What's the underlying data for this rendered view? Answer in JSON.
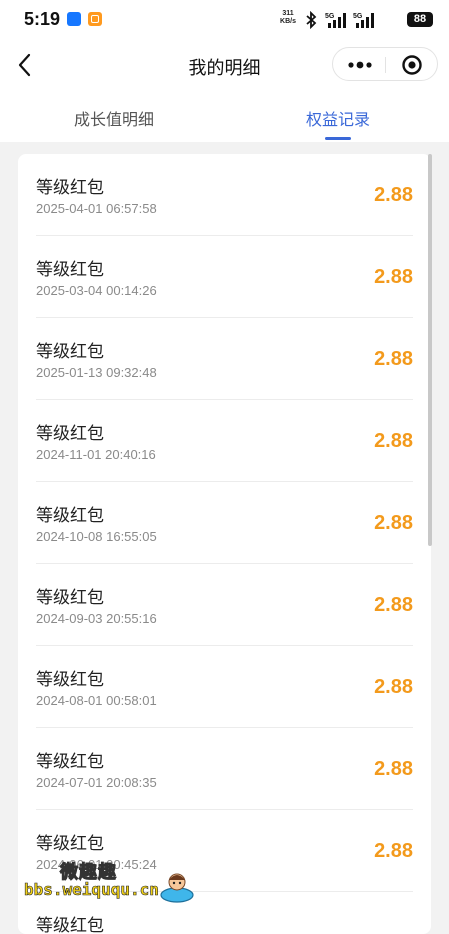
{
  "status_bar": {
    "time": "5:19",
    "net_speed_value": "311",
    "net_speed_unit": "KB/s",
    "signal_1_label": "5G",
    "signal_2_label": "5G",
    "battery": "88"
  },
  "nav": {
    "title": "我的明细"
  },
  "tabs": [
    {
      "label": "成长值明细",
      "active": false
    },
    {
      "label": "权益记录",
      "active": true
    }
  ],
  "records": [
    {
      "title": "等级红包",
      "time": "2025-04-01 06:57:58",
      "amount": "2.88"
    },
    {
      "title": "等级红包",
      "time": "2025-03-04 00:14:26",
      "amount": "2.88"
    },
    {
      "title": "等级红包",
      "time": "2025-01-13 09:32:48",
      "amount": "2.88"
    },
    {
      "title": "等级红包",
      "time": "2024-11-01 20:40:16",
      "amount": "2.88"
    },
    {
      "title": "等级红包",
      "time": "2024-10-08 16:55:05",
      "amount": "2.88"
    },
    {
      "title": "等级红包",
      "time": "2024-09-03 20:55:16",
      "amount": "2.88"
    },
    {
      "title": "等级红包",
      "time": "2024-08-01 00:58:01",
      "amount": "2.88"
    },
    {
      "title": "等级红包",
      "time": "2024-07-01 20:08:35",
      "amount": "2.88"
    },
    {
      "title": "等级红包",
      "time": "2024-06-01 00:45:24",
      "amount": "2.88"
    },
    {
      "title": "等级红包",
      "time": "",
      "amount": ""
    }
  ],
  "watermark": {
    "text_cn": "微趣趣",
    "url": "bbs.weiququ.cn"
  },
  "colors": {
    "accent_blue": "#3a68d8",
    "amount_orange": "#f39a1c",
    "page_bg": "#f2f2f2"
  }
}
